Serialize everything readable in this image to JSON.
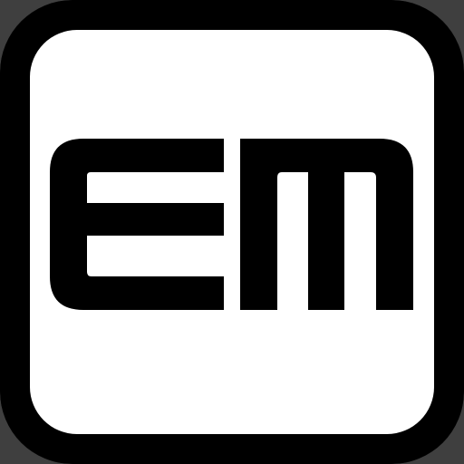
{
  "icon": {
    "name": "em-app-icon",
    "glyph_text": "EM",
    "colors": {
      "background": "#3f3f3f",
      "frame": "#000000",
      "face": "#ffffff",
      "glyph": "#000000"
    }
  }
}
